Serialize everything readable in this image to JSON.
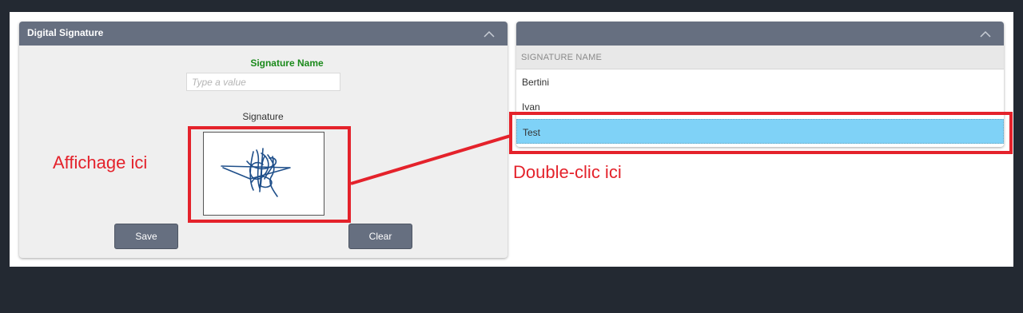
{
  "signature_panel": {
    "title": "Digital Signature",
    "name_label": "Signature Name",
    "name_placeholder": "Type a value",
    "signature_label": "Signature",
    "save_label": "Save",
    "clear_label": "Clear"
  },
  "list_panel": {
    "title": "",
    "column_header": "SIGNATURE NAME",
    "rows": [
      {
        "name": "Bertini"
      },
      {
        "name": "Ivan"
      },
      {
        "name": "Test"
      }
    ],
    "selected_row": "Test"
  },
  "annotations": {
    "left_text": "Affichage ici",
    "right_text": "Double-clic ici",
    "color": "#e4222b"
  },
  "colors": {
    "header": "#666f80",
    "selected_row": "#7fd2f7",
    "name_label": "#1b8a1b",
    "background": "#232932"
  },
  "icons": {
    "collapse": "chevron-up-icon"
  }
}
